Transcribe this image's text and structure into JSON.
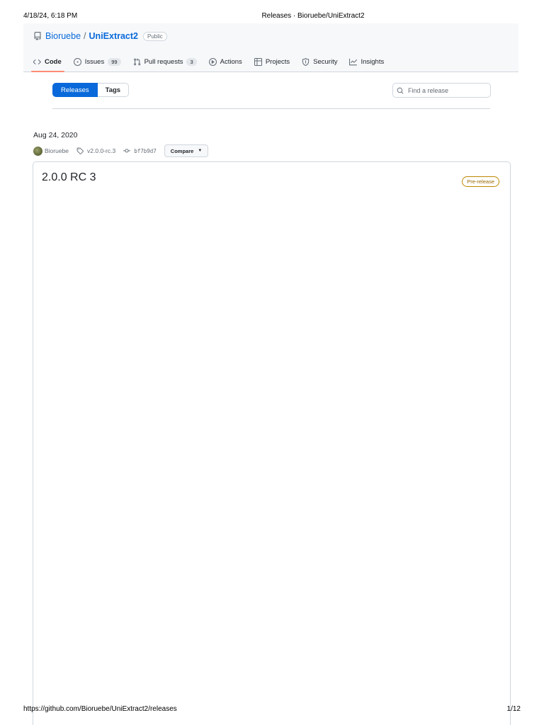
{
  "print": {
    "datetime": "4/18/24, 6:18 PM",
    "doc_title": "Releases · Bioruebe/UniExtract2",
    "url": "https://github.com/Bioruebe/UniExtract2/releases",
    "page_counter": "1/12"
  },
  "repo": {
    "owner": "Bioruebe",
    "separator": "/",
    "name": "UniExtract2",
    "visibility": "Public"
  },
  "tabs": [
    {
      "label": "Code",
      "icon": "code-icon",
      "selected": true
    },
    {
      "label": "Issues",
      "icon": "issue-opened-icon",
      "count": "99"
    },
    {
      "label": "Pull requests",
      "icon": "git-pull-request-icon",
      "count": "3"
    },
    {
      "label": "Actions",
      "icon": "play-icon"
    },
    {
      "label": "Projects",
      "icon": "table-icon"
    },
    {
      "label": "Security",
      "icon": "shield-icon"
    },
    {
      "label": "Insights",
      "icon": "graph-icon"
    }
  ],
  "subnav": {
    "releases_label": "Releases",
    "tags_label": "Tags"
  },
  "search": {
    "placeholder": "Find a release"
  },
  "release": {
    "date": "Aug 24, 2020",
    "author": "Bioruebe",
    "tag": "v2.0.0-rc.3",
    "commit": "bf7b9d7",
    "compare_label": "Compare",
    "title": "2.0.0 RC 3",
    "badge": "Pre-release"
  },
  "colors": {
    "accent": "#0969da",
    "selected_tab_underline": "#fd8c73",
    "prerelease": "#9a6700"
  }
}
